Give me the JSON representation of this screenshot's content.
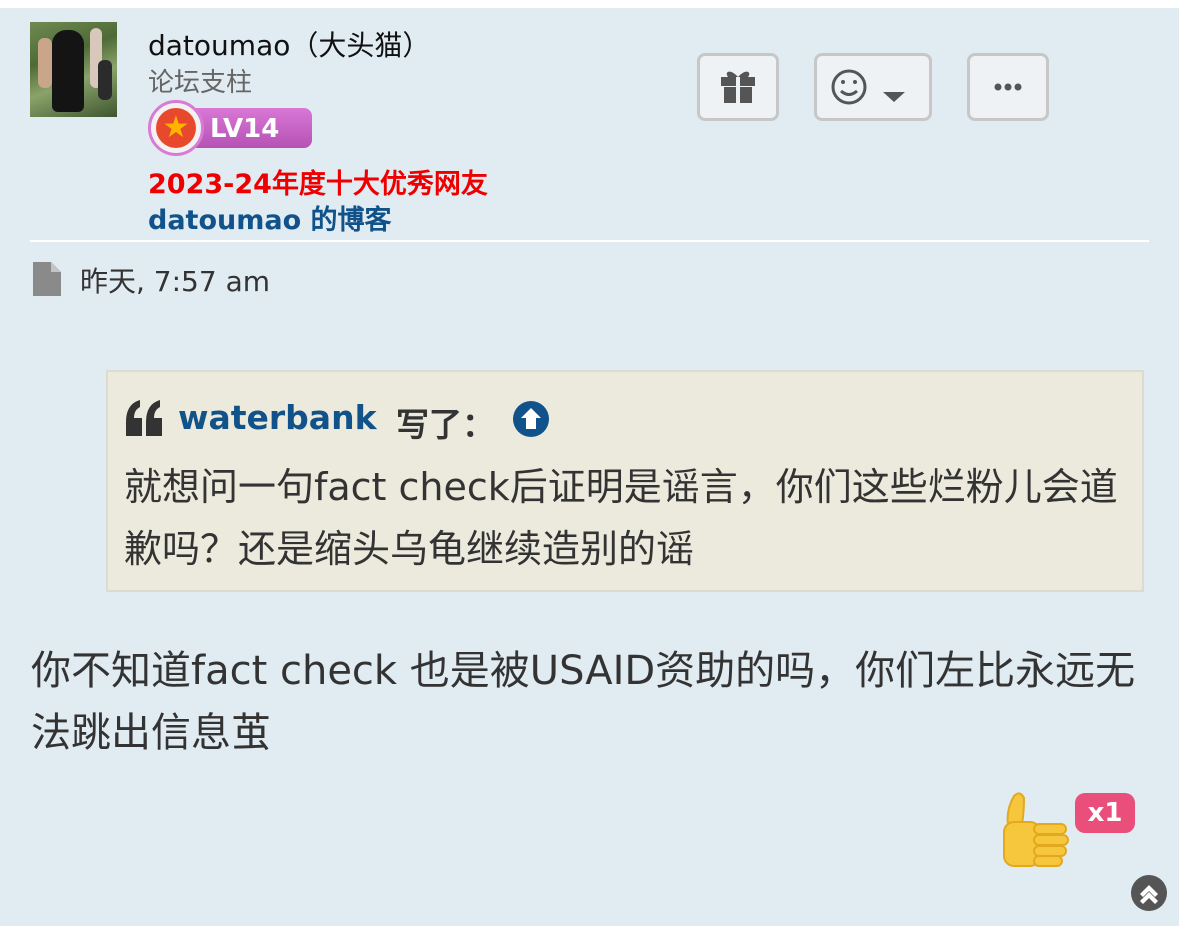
{
  "author": {
    "username": "datoumao（大头猫）",
    "rank": "论坛支柱",
    "level": "LV14",
    "honor": "2023-24年度十大优秀网友",
    "blog_link": "datoumao 的博客"
  },
  "actions": {
    "icons": [
      "gift-icon",
      "smiley-icon",
      "chevron-down-icon",
      "ellipsis-icon"
    ]
  },
  "post": {
    "timestamp": "昨天, 7:57 am",
    "quote": {
      "user": "waterbank",
      "wrote": "写了：",
      "text": "就想问一句fact check后证明是谣言，你们这些烂粉儿会道歉吗？还是缩头乌龟继续造别的谣"
    },
    "body": "你不知道fact check 也是被USAID资助的吗，你们左比永远无法跳出信息茧",
    "reaction": {
      "icon": "thumbs-up-icon",
      "count": "x1"
    }
  },
  "colors": {
    "post_bg": "#e1ebf2",
    "link": "#105289",
    "honor": "#ee0000",
    "quote_bg": "#ebeadd",
    "badge": "#c95ec7",
    "reaction_badge": "#e94f7a"
  }
}
